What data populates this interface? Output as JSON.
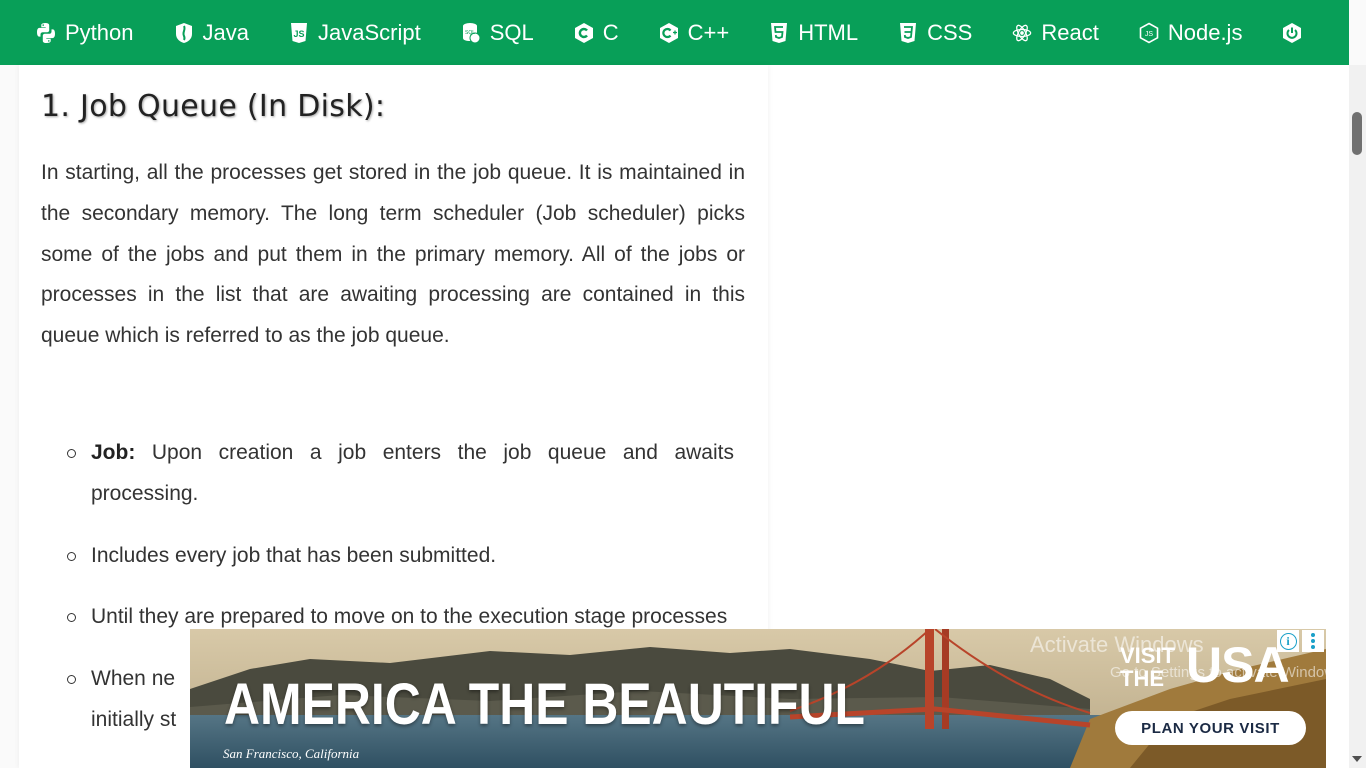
{
  "nav": {
    "items": [
      {
        "label": "Python",
        "icon": "python-icon"
      },
      {
        "label": "Java",
        "icon": "java-icon"
      },
      {
        "label": "JavaScript",
        "icon": "javascript-icon"
      },
      {
        "label": "SQL",
        "icon": "sql-icon"
      },
      {
        "label": "C",
        "icon": "c-icon"
      },
      {
        "label": "C++",
        "icon": "cpp-icon"
      },
      {
        "label": "HTML",
        "icon": "html-icon"
      },
      {
        "label": "CSS",
        "icon": "css-icon"
      },
      {
        "label": "React",
        "icon": "react-icon"
      },
      {
        "label": "Node.js",
        "icon": "nodejs-icon"
      }
    ],
    "background": "#089f58"
  },
  "article": {
    "heading": "1. Job Queue (In Disk):",
    "paragraph": "In starting, all the processes get stored in the job queue. It is maintained in the secondary memory. The long term scheduler (Job scheduler) picks some of the jobs and put them in the primary memory. All of the jobs or processes in the list that are awaiting processing are contained in this queue which is referred to as the job queue.",
    "bullets": [
      {
        "bold": "Job:",
        "text": " Upon creation a job enters the job queue and awaits processing."
      },
      {
        "bold": "",
        "text": "Includes every job that has been submitted."
      },
      {
        "bold": "",
        "text": "Until they are prepared to move on to the execution stage processes"
      },
      {
        "bold": "",
        "text": "When ne"
      }
    ],
    "bullet_tail": "initially st"
  },
  "ad": {
    "title": "AMERICA THE BEAUTIFUL",
    "caption": "San Francisco, California",
    "brand_visit": "VISIT THE",
    "brand_usa": "USA",
    "cta": "PLAN YOUR VISIT"
  },
  "watermark": {
    "line1": "Activate Windows",
    "line2": "Go to Settings to activate Windows."
  }
}
